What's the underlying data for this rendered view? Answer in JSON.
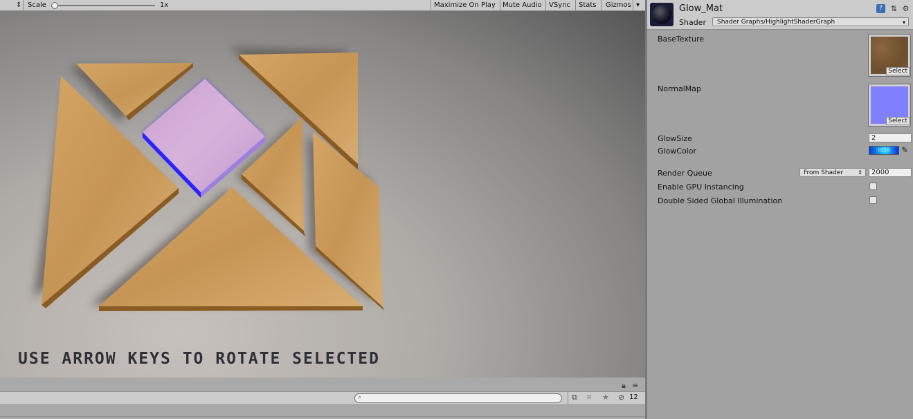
{
  "game_view": {
    "toolbar": {
      "display_arrows": "⇕",
      "scale_label": "Scale",
      "scale_value": "1x",
      "maximize_on_play": "Maximize On Play",
      "mute_audio": "Mute Audio",
      "vsync": "VSync",
      "stats": "Stats",
      "gizmos": "Gizmos",
      "gizmos_arrow": "▾"
    },
    "hint_text": "USE ARROW KEYS TO ROTATE SELECTED",
    "scene": {
      "wood_color": "#c99a5a",
      "wood_edge_color": "#8a5c23",
      "selected_color": "#cfa3d4",
      "selected_glow": "#3a3cff"
    }
  },
  "console": {
    "lock_icon": "lock-icon",
    "menu_icon": "menu-icon",
    "search_placeholder": "",
    "hidden_count": "12"
  },
  "inspector": {
    "material_name": "Glow_Mat",
    "shader_label": "Shader",
    "shader_value": "Shader Graphs/HighlightShaderGraph",
    "properties": {
      "base_texture_label": "BaseTexture",
      "base_texture_select": "Select",
      "normal_map_label": "NormalMap",
      "normal_map_select": "Select",
      "glow_size_label": "GlowSize",
      "glow_size_value": "2",
      "glow_color_label": "GlowColor",
      "glow_color_badge": "HDR",
      "render_queue_label": "Render Queue",
      "render_queue_mode": "From Shader",
      "render_queue_value": "2000",
      "gpu_instancing_label": "Enable GPU Instancing",
      "gpu_instancing_checked": false,
      "double_sided_gi_label": "Double Sided Global Illumination",
      "double_sided_gi_checked": false
    },
    "colors": {
      "base_texture": "#7b5a35",
      "normal_map": "#8080ff"
    }
  }
}
